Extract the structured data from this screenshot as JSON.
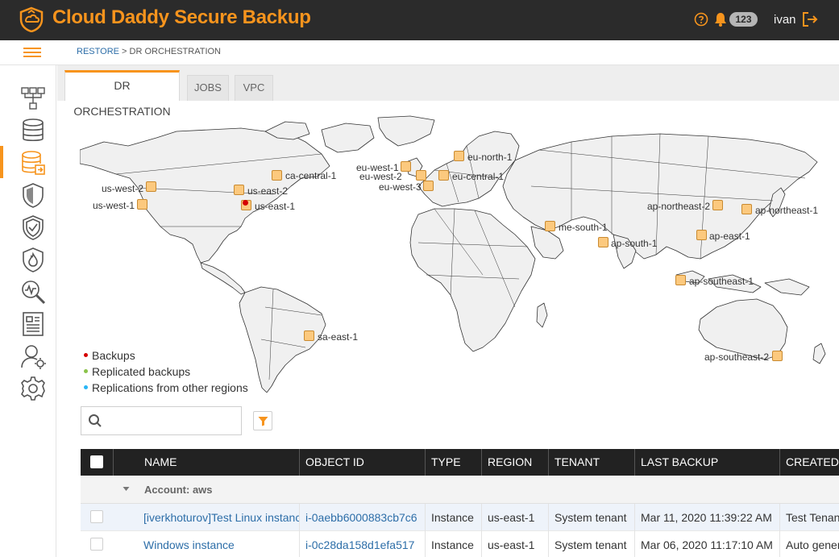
{
  "app": {
    "title": "Cloud Daddy Secure Backup",
    "brand_color": "#f7941d",
    "topbar_color": "#2b2b2b"
  },
  "header": {
    "notification_count": "123",
    "user_name": "ivan",
    "icons": [
      "help-icon",
      "bell-icon",
      "logout-icon"
    ]
  },
  "breadcrumb": {
    "parent": "RESTORE",
    "separator": " > ",
    "current": "DR ORCHESTRATION"
  },
  "sidebar": {
    "items": [
      {
        "icon": "network-icon"
      },
      {
        "icon": "database-icon"
      },
      {
        "icon": "database-restore-icon",
        "active": true
      },
      {
        "icon": "shield-half-icon"
      },
      {
        "icon": "shield-check-icon"
      },
      {
        "icon": "shield-fire-icon"
      },
      {
        "icon": "magnifier-chart-icon"
      },
      {
        "icon": "report-icon"
      },
      {
        "icon": "user-settings-icon"
      },
      {
        "icon": "gear-icon"
      }
    ]
  },
  "tabs": [
    {
      "label": "DR ORCHESTRATION",
      "active": true
    },
    {
      "label": "JOBS"
    },
    {
      "label": "VPC"
    }
  ],
  "map": {
    "regions": [
      {
        "label": "us-west-2"
      },
      {
        "label": "us-west-1"
      },
      {
        "label": "ca-central-1"
      },
      {
        "label": "us-east-2"
      },
      {
        "label": "us-east-1",
        "has_backups": true
      },
      {
        "label": "sa-east-1"
      },
      {
        "label": "eu-west-1"
      },
      {
        "label": "eu-west-2"
      },
      {
        "label": "eu-west-3"
      },
      {
        "label": "eu-central-1"
      },
      {
        "label": "eu-north-1"
      },
      {
        "label": "me-south-1"
      },
      {
        "label": "ap-south-1"
      },
      {
        "label": "ap-northeast-2"
      },
      {
        "label": "ap-northeast-1"
      },
      {
        "label": "ap-east-1"
      },
      {
        "label": "ap-southeast-1"
      },
      {
        "label": "ap-southeast-2"
      }
    ],
    "marker_color": "#fcc97e"
  },
  "legend": [
    {
      "label": "Backups",
      "color": "#d50000"
    },
    {
      "label": "Replicated backups",
      "color": "#8bc34a"
    },
    {
      "label": "Replications from other regions",
      "color": "#29b6f6"
    }
  ],
  "search": {
    "placeholder": "",
    "value": ""
  },
  "table": {
    "columns": [
      "NAME",
      "OBJECT ID",
      "TYPE",
      "REGION",
      "TENANT",
      "LAST BACKUP",
      "CREATED"
    ],
    "group_label": "Account: aws",
    "rows": [
      {
        "name": "[iverkhoturov]Test Linux instance",
        "object_id": "i-0aebb6000883cb7c6",
        "type": "Instance",
        "region": "us-east-1",
        "tenant": "System tenant",
        "last_backup": "Mar 11, 2020 11:39:22 AM",
        "created": "Test Tenant"
      },
      {
        "name": "Windows instance",
        "object_id": "i-0c28da158d1efa517",
        "type": "Instance",
        "region": "us-east-1",
        "tenant": "System tenant",
        "last_backup": "Mar 06, 2020 11:17:10 AM",
        "created": "Auto generated"
      }
    ]
  }
}
